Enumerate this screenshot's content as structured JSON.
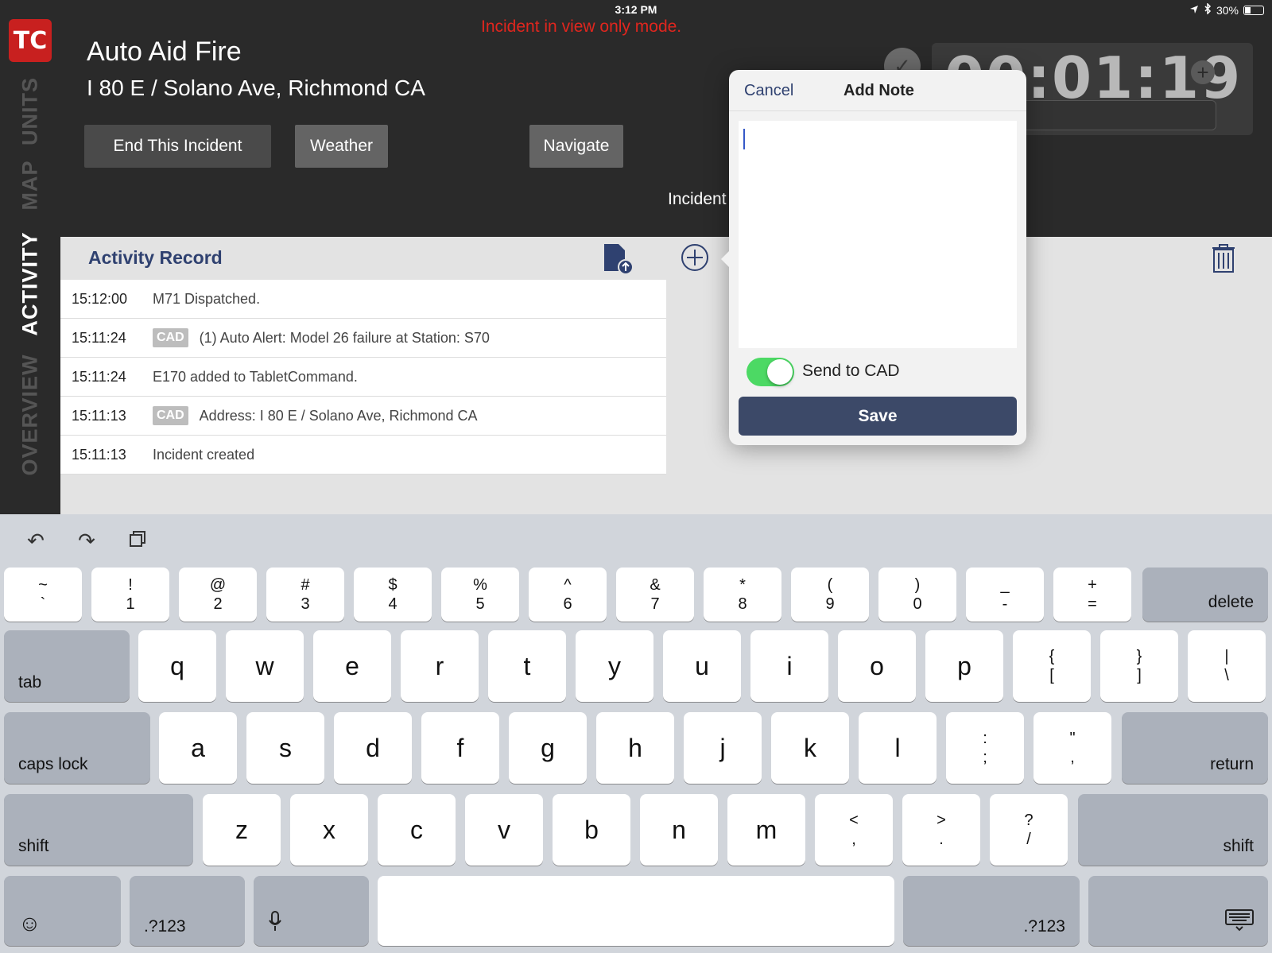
{
  "status_bar": {
    "device": "iPad",
    "time": "3:12 PM",
    "battery": "30%"
  },
  "sidebar": {
    "logo": "TC",
    "tabs": [
      {
        "label": "UNITS",
        "active": false
      },
      {
        "label": "MAP",
        "active": false
      },
      {
        "label": "ACTIVITY",
        "active": true
      },
      {
        "label": "OVERVIEW",
        "active": false
      }
    ]
  },
  "header": {
    "view_only_notice": "Incident in view only mode.",
    "title": "Auto Aid Fire",
    "address": "I 80 E / Solano Ave, Richmond CA",
    "buttons": {
      "end": "End This Incident",
      "weather": "Weather",
      "navigate": "Navigate"
    },
    "incident_label": "Incident",
    "timer": "00:01:19"
  },
  "activity": {
    "title": "Activity Record",
    "rows": [
      {
        "time": "15:12:00",
        "cad": "",
        "message": "M71 Dispatched."
      },
      {
        "time": "15:11:24",
        "cad": "CAD",
        "message": "(1) Auto Alert: Model 26 failure at Station: S70"
      },
      {
        "time": "15:11:24",
        "cad": "",
        "message": "E170 added to TabletCommand."
      },
      {
        "time": "15:11:13",
        "cad": "CAD",
        "message": "Address: I 80 E / Solano Ave, Richmond CA"
      },
      {
        "time": "15:11:13",
        "cad": "",
        "message": "Incident created"
      }
    ]
  },
  "add_note": {
    "cancel": "Cancel",
    "title": "Add Note",
    "note_value": "",
    "send_to_cad_label": "Send to CAD",
    "send_to_cad_on": true,
    "save": "Save"
  },
  "keyboard": {
    "row1": [
      {
        "top": "~",
        "bot": "`"
      },
      {
        "top": "!",
        "bot": "1"
      },
      {
        "top": "@",
        "bot": "2"
      },
      {
        "top": "#",
        "bot": "3"
      },
      {
        "top": "$",
        "bot": "4"
      },
      {
        "top": "%",
        "bot": "5"
      },
      {
        "top": "^",
        "bot": "6"
      },
      {
        "top": "&",
        "bot": "7"
      },
      {
        "top": "*",
        "bot": "8"
      },
      {
        "top": "(",
        "bot": "9"
      },
      {
        "top": ")",
        "bot": "0"
      },
      {
        "top": "_",
        "bot": "-"
      },
      {
        "top": "+",
        "bot": "="
      }
    ],
    "delete": "delete",
    "tab": "tab",
    "row2": [
      "q",
      "w",
      "e",
      "r",
      "t",
      "y",
      "u",
      "i",
      "o",
      "p"
    ],
    "row2_sym": [
      {
        "top": "{",
        "bot": "["
      },
      {
        "top": "}",
        "bot": "]"
      },
      {
        "top": "|",
        "bot": "\\"
      }
    ],
    "caps_lock": "caps lock",
    "row3": [
      "a",
      "s",
      "d",
      "f",
      "g",
      "h",
      "j",
      "k",
      "l"
    ],
    "row3_sym": [
      {
        "top": ":",
        "bot": ";"
      },
      {
        "top": "\"",
        "bot": ","
      }
    ],
    "return": "return",
    "shift": "shift",
    "row4": [
      "z",
      "x",
      "c",
      "v",
      "b",
      "n",
      "m"
    ],
    "row4_sym": [
      {
        "top": "<",
        "bot": ","
      },
      {
        "top": ">",
        "bot": "."
      },
      {
        "top": "?",
        "bot": "/"
      }
    ],
    "numbers": ".?123"
  }
}
